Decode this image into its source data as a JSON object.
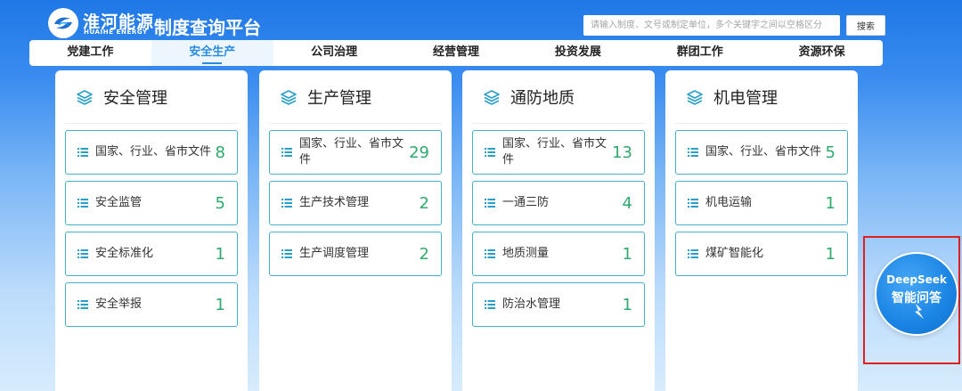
{
  "header": {
    "logo_cn": "淮河能源",
    "logo_en": "HUAIHE ENERGY",
    "platform_title": "制度查询平台",
    "search_placeholder": "请输入制度、文号或制定单位，多个关键字之间以空格区分",
    "search_button": "搜索"
  },
  "nav": {
    "tabs": [
      {
        "label": "党建工作"
      },
      {
        "label": "安全生产",
        "active": true
      },
      {
        "label": "公司治理"
      },
      {
        "label": "经营管理"
      },
      {
        "label": "投资发展"
      },
      {
        "label": "群团工作"
      },
      {
        "label": "资源环保"
      }
    ]
  },
  "columns": [
    {
      "title": "安全管理",
      "icon": "layers-icon",
      "items": [
        {
          "label": "国家、行业、省市文件",
          "count": "8"
        },
        {
          "label": "安全监管",
          "count": "5"
        },
        {
          "label": "安全标准化",
          "count": "1"
        },
        {
          "label": "安全举报",
          "count": "1"
        }
      ]
    },
    {
      "title": "生产管理",
      "icon": "layers-icon",
      "items": [
        {
          "label": "国家、行业、省市文件",
          "count": "29"
        },
        {
          "label": "生产技术管理",
          "count": "2"
        },
        {
          "label": "生产调度管理",
          "count": "2"
        }
      ]
    },
    {
      "title": "通防地质",
      "icon": "layers-icon",
      "items": [
        {
          "label": "国家、行业、省市文件",
          "count": "13"
        },
        {
          "label": "一通三防",
          "count": "4"
        },
        {
          "label": "地质测量",
          "count": "1"
        },
        {
          "label": "防治水管理",
          "count": "1"
        }
      ]
    },
    {
      "title": "机电管理",
      "icon": "layers-icon",
      "items": [
        {
          "label": "国家、行业、省市文件",
          "count": "5"
        },
        {
          "label": "机电运输",
          "count": "1"
        },
        {
          "label": "煤矿智能化",
          "count": "1"
        }
      ]
    }
  ],
  "deepseek": {
    "en": "DeepSeek",
    "cn": "智能问答"
  },
  "colors": {
    "accent": "#2a8be2",
    "item_border": "#43b1cc",
    "count": "#2eaa6c",
    "highlight_frame": "#e02020"
  }
}
